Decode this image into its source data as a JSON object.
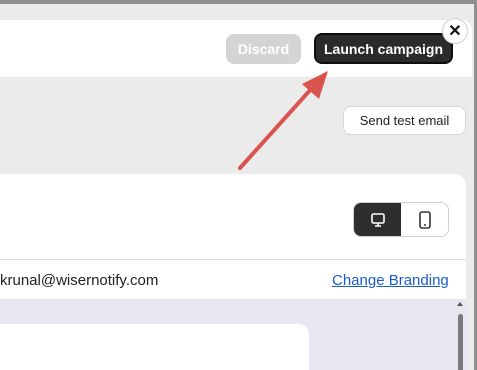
{
  "header": {
    "discard_label": "Discard",
    "launch_label": "Launch campaign",
    "close_glyph": "✕"
  },
  "toolbar": {
    "send_test_label": "Send test email"
  },
  "preview": {
    "device_options": [
      {
        "icon": "desktop-icon",
        "active": true
      },
      {
        "icon": "mobile-icon",
        "active": false
      }
    ],
    "sender_email": "krunal@wisernotify.com",
    "change_branding_label": "Change Branding"
  },
  "colors": {
    "accent_dark": "#2b2b2b",
    "annotation_arrow": "#d9534f",
    "link": "#1a5dc8",
    "canvas": "#e9e6f1"
  }
}
